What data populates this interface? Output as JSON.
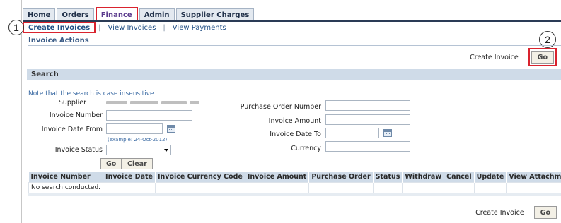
{
  "tabs": {
    "items": [
      "Home",
      "Orders",
      "Finance",
      "Admin",
      "Supplier Charges"
    ],
    "active": "Finance"
  },
  "subtabs": {
    "create_invoices": "Create Invoices",
    "view_invoices": "View Invoices",
    "view_payments": "View Payments"
  },
  "callouts": {
    "one": "1",
    "two": "2"
  },
  "invoice_actions": {
    "title": "Invoice Actions",
    "create_label": "Create Invoice",
    "go_label": "Go"
  },
  "search": {
    "title": "Search",
    "note": "Note that the search is case insensitive",
    "supplier_label": "Supplier",
    "invoice_number_label": "Invoice Number",
    "invoice_date_from_label": "Invoice Date From",
    "date_hint": "(example: 24-Oct-2012)",
    "invoice_status_label": "Invoice Status",
    "po_number_label": "Purchase Order Number",
    "invoice_amount_label": "Invoice Amount",
    "invoice_date_to_label": "Invoice Date To",
    "currency_label": "Currency",
    "go_label": "Go",
    "clear_label": "Clear"
  },
  "results": {
    "columns": [
      "Invoice Number",
      "Invoice Date",
      "Invoice Currency Code",
      "Invoice Amount",
      "Purchase Order",
      "Status",
      "Withdraw",
      "Cancel",
      "Update",
      "View Attachments"
    ],
    "empty_text": "No search conducted."
  },
  "bottom_actions": {
    "create_label": "Create Invoice",
    "go_label": "Go"
  },
  "colors": {
    "highlight": "#d9232e",
    "header_band": "#cfdbe8",
    "link": "#214f85"
  },
  "icons": [
    "calendar-icon",
    "dropdown-arrow-icon"
  ]
}
